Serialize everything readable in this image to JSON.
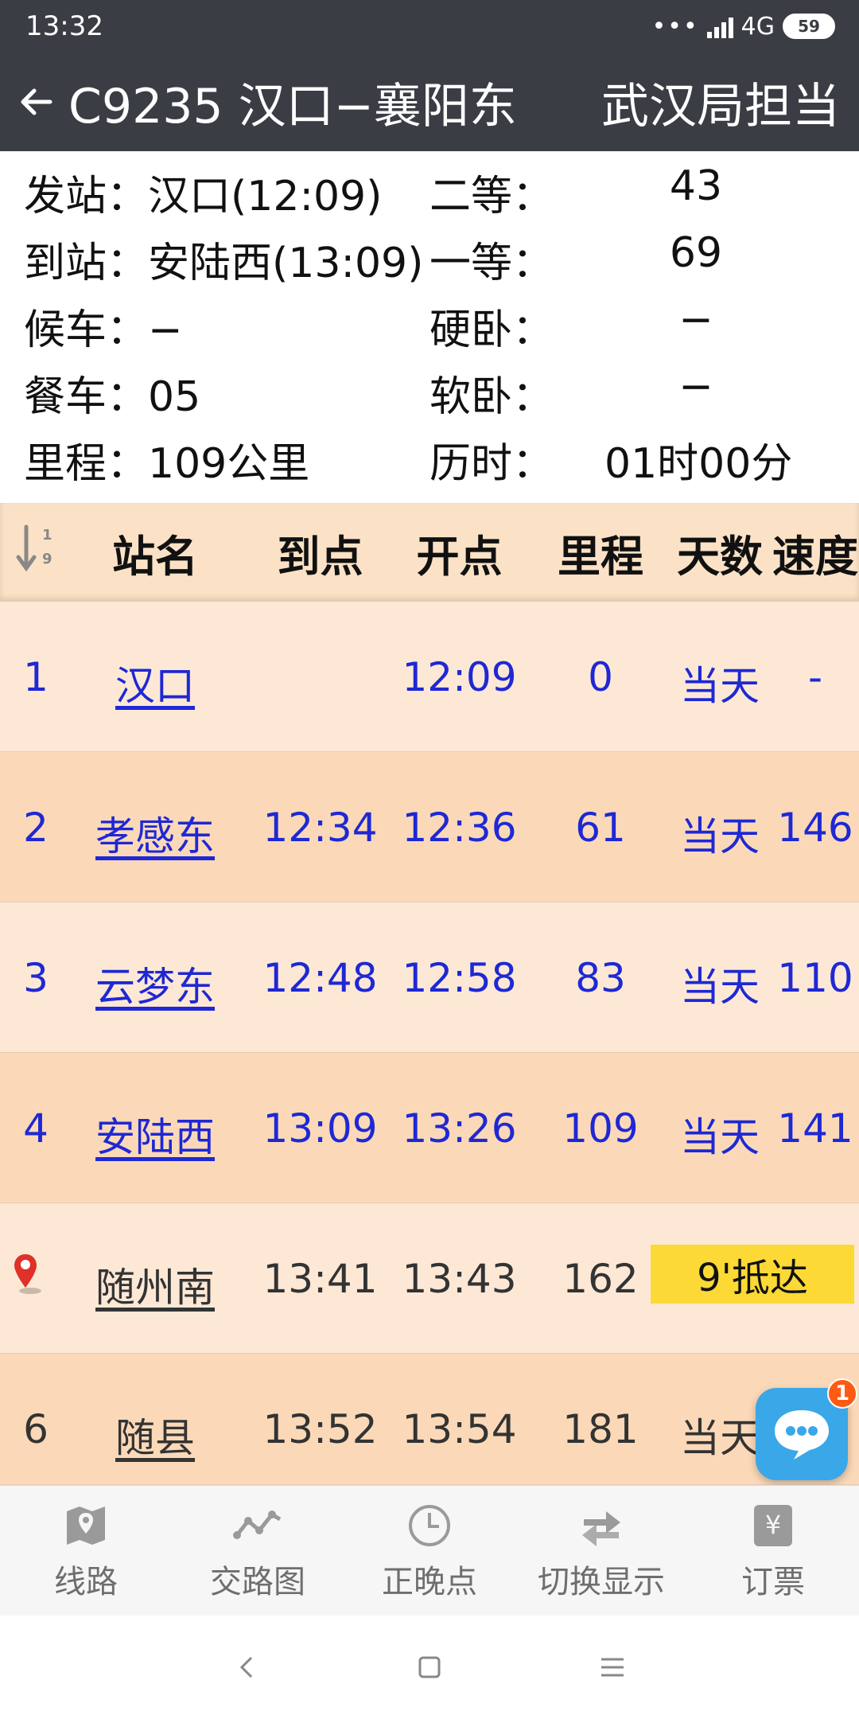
{
  "status_bar": {
    "time": "13:32",
    "network": "4G",
    "battery": "59"
  },
  "app_bar": {
    "title": "C9235 汉口−襄阳东",
    "bureau": "武汉局担当"
  },
  "info": {
    "rows": [
      {
        "k1": "发站：汉口(12:09)",
        "k2": "二等：",
        "v2": "43"
      },
      {
        "k1": "到站：安陆西(13:09)",
        "k2": "一等：",
        "v2": "69"
      },
      {
        "k1": "候车：−",
        "k2": "硬卧：",
        "v2": "−"
      },
      {
        "k1": "餐车：05",
        "k2": "软卧：",
        "v2": "−"
      },
      {
        "k1": "里程：109公里",
        "k2": "历时：",
        "v2": "01时00分"
      }
    ]
  },
  "table": {
    "headers": {
      "station": "站名",
      "arrive": "到点",
      "depart": "开点",
      "distance": "里程",
      "day": "天数",
      "speed": "速度"
    },
    "rows": [
      {
        "idx": "1",
        "name": "汉口",
        "arrive": "",
        "depart": "12:09",
        "distance": "0",
        "day": "当天",
        "speed": "-"
      },
      {
        "idx": "2",
        "name": "孝感东",
        "arrive": "12:34",
        "depart": "12:36",
        "distance": "61",
        "day": "当天",
        "speed": "146"
      },
      {
        "idx": "3",
        "name": "云梦东",
        "arrive": "12:48",
        "depart": "12:58",
        "distance": "83",
        "day": "当天",
        "speed": "110"
      },
      {
        "idx": "4",
        "name": "安陆西",
        "arrive": "13:09",
        "depart": "13:26",
        "distance": "109",
        "day": "当天",
        "speed": "141"
      },
      {
        "idx": "",
        "name": "随州南",
        "arrive": "13:41",
        "depart": "13:43",
        "distance": "162",
        "badge": "9'抵达"
      },
      {
        "idx": "6",
        "name": "随县",
        "arrive": "13:52",
        "depart": "13:54",
        "distance": "181",
        "day": "当天",
        "speed": ""
      }
    ]
  },
  "chat": {
    "badge": "1"
  },
  "bottom_nav": [
    {
      "label": "线路",
      "icon": "map-icon"
    },
    {
      "label": "交路图",
      "icon": "route-chart-icon"
    },
    {
      "label": "正晚点",
      "icon": "clock-icon"
    },
    {
      "label": "切换显示",
      "icon": "swap-icon"
    },
    {
      "label": "订票",
      "icon": "ticket-icon"
    }
  ],
  "colors": {
    "bar": "#3a3d44",
    "link_blue": "#1e28d4",
    "row_light": "#fde8d6",
    "row_dark": "#fbd9b8",
    "badge_yellow": "#fcd934"
  }
}
